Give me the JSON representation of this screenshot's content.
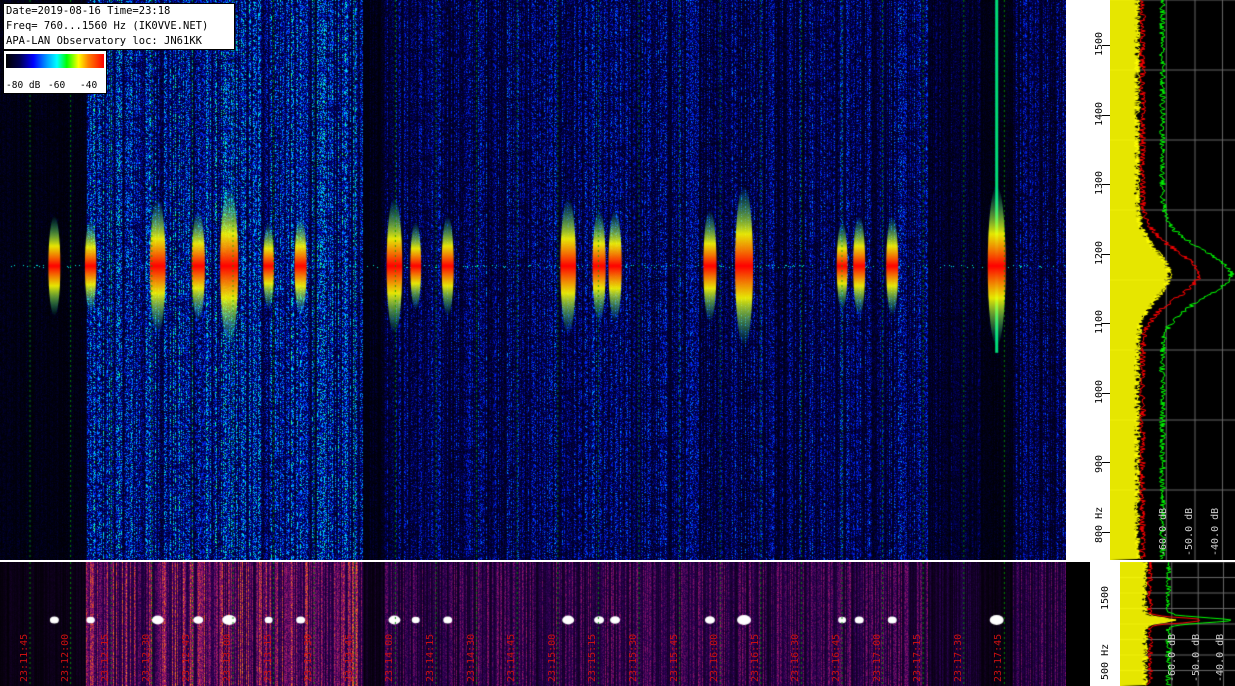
{
  "info": {
    "line1": "Date=2019-08-16 Time=23:18",
    "line2": "Freq= 760...1560 Hz (IK0VVE.NET)",
    "line3": "APA-LAN Observatory loc: JN61KK"
  },
  "legend": {
    "ticks": [
      "-80 dB",
      "-60",
      "-40"
    ]
  },
  "colors": {
    "accent_red": "#ff0000",
    "spectrum_yellow": "#ffff00",
    "spectrum_green": "#00ff00",
    "time_label": "#cc1010"
  },
  "chart_data": [
    {
      "type": "heatmap",
      "name_hint": "waterfall spectrogram",
      "y_tick_labels": [
        "1500",
        "1400",
        "1300",
        "1200",
        "1100",
        "1000",
        "900",
        "800 Hz"
      ],
      "ylim": [
        760,
        1560
      ],
      "carrier_hz": 1180,
      "bursts": [
        {
          "x": 0.051,
          "strength": 0.5
        },
        {
          "x": 0.085,
          "strength": 0.45
        },
        {
          "x": 0.148,
          "strength": 0.8
        },
        {
          "x": 0.186,
          "strength": 0.6
        },
        {
          "x": 0.215,
          "strength": 1.0
        },
        {
          "x": 0.252,
          "strength": 0.4
        },
        {
          "x": 0.282,
          "strength": 0.5
        },
        {
          "x": 0.37,
          "strength": 0.8
        },
        {
          "x": 0.39,
          "strength": 0.4
        },
        {
          "x": 0.42,
          "strength": 0.5
        },
        {
          "x": 0.533,
          "strength": 0.8
        },
        {
          "x": 0.562,
          "strength": 0.6
        },
        {
          "x": 0.577,
          "strength": 0.6
        },
        {
          "x": 0.666,
          "strength": 0.6
        },
        {
          "x": 0.698,
          "strength": 1.0
        },
        {
          "x": 0.79,
          "strength": 0.4
        },
        {
          "x": 0.806,
          "strength": 0.5
        },
        {
          "x": 0.837,
          "strength": 0.5
        },
        {
          "x": 0.935,
          "strength": 1.0
        }
      ]
    },
    {
      "type": "heatmap",
      "name_hint": "compressed waterfall",
      "time_labels": [
        "23:11:45",
        "23:12:00",
        "23:12:15",
        "23:12:30",
        "23:12:45",
        "23:13:00",
        "23:13:15",
        "23:13:30",
        "23:13:45",
        "23:14:00",
        "23:14:15",
        "23:14:30",
        "23:14:45",
        "23:15:00",
        "23:15:15",
        "23:15:30",
        "23:15:45",
        "23:16:00",
        "23:16:15",
        "23:16:30",
        "23:16:45",
        "23:17:00",
        "23:17:15",
        "23:17:30",
        "23:17:45"
      ],
      "y_tick_labels": [
        "1500",
        "500 Hz"
      ]
    },
    {
      "type": "line",
      "name_hint": "spectrum profile",
      "series": [
        {
          "color": "#ffff00",
          "values": [
            0.2,
            0.2,
            0.2,
            0.22,
            0.35,
            0.2,
            0.2,
            0.2
          ]
        },
        {
          "color": "#ff0000",
          "values": [
            0.28,
            0.28,
            0.28,
            0.5,
            0.3,
            0.28,
            0.28,
            0.28
          ]
        },
        {
          "color": "#00ff00",
          "values": [
            0.4,
            0.42,
            0.45,
            0.8,
            0.5,
            0.4,
            0.38,
            0.36
          ]
        }
      ],
      "db_labels": [
        "-60.0 dB",
        "-50.0 dB",
        "-40.0 dB"
      ],
      "db_labels_bottom": [
        "-60.0 dB",
        "-50.0 dB",
        "-40.0 dB"
      ]
    }
  ]
}
